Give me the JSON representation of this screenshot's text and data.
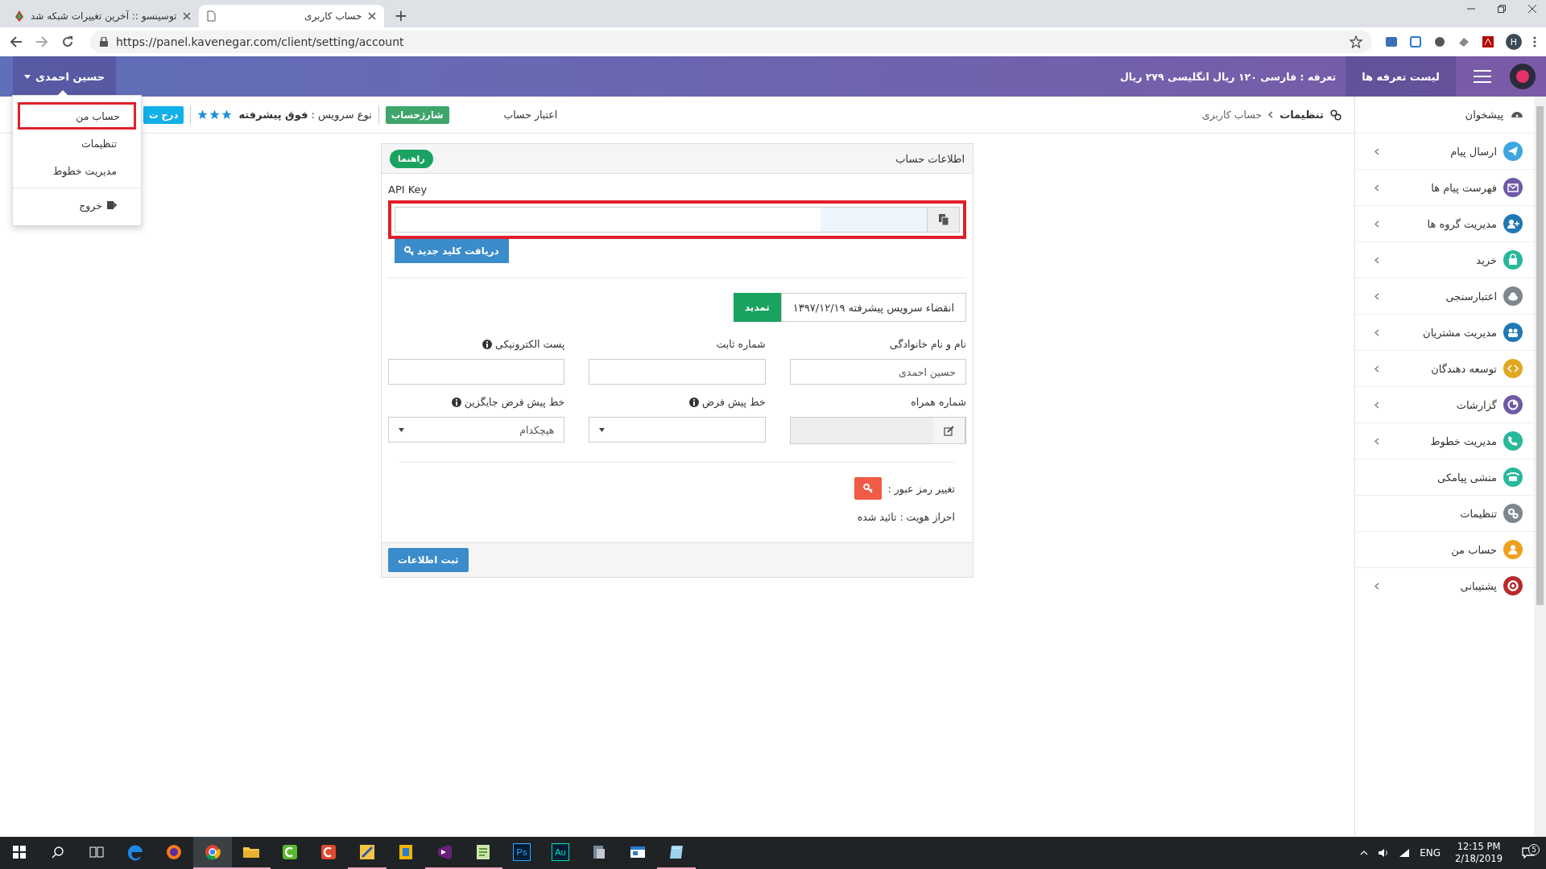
{
  "browser": {
    "tabs": [
      {
        "title": "حساب کاربری",
        "selected": true
      },
      {
        "title": "توسینسو :: آخرین تغییرات شبکه شد",
        "selected": false
      }
    ],
    "new_tab": "+",
    "url": "https://panel.kavenegar.com/client/setting/account",
    "profile": "H"
  },
  "header": {
    "tariff_button": "لیست تعرفه ها",
    "tariff": "تعرفه : فارسی ۱۲۰ ریال انگلیسی ۲۷۹ ریال",
    "user": "حسین احمدی",
    "user_menu_open": true
  },
  "user_menu": [
    {
      "label": "حساب من",
      "kind": "link",
      "highlighted": true
    },
    {
      "label": "تنظیمات",
      "kind": "link",
      "highlighted": false
    },
    {
      "label": "مدیریت خطوط",
      "kind": "link",
      "highlighted": false
    },
    {
      "label": "خروج",
      "kind": "logout",
      "highlighted": false
    }
  ],
  "toolbar": {
    "breadcrumb": [
      {
        "label": "تنظیمات"
      },
      {
        "label": "حساب کاربری"
      }
    ],
    "credit_label": "اعتبار حساب",
    "charge_button": "شارژحساب",
    "service": "نوع سرویس : **فوق پیشرفته**",
    "stars": 3,
    "insert_button": "درج ت"
  },
  "sidebar": {
    "home": "پیشخوان",
    "items": [
      {
        "label": "ارسال پیام",
        "color": "#3ea6e0",
        "has_submenu": true
      },
      {
        "label": "فهرست پیام ها",
        "color": "#6f5aa8",
        "has_submenu": true
      },
      {
        "label": "مدیریت گروه ها",
        "color": "#1f78b4",
        "has_submenu": true
      },
      {
        "label": "خرید",
        "color": "#26b99a",
        "has_submenu": true
      },
      {
        "label": "اعتبارسنجی",
        "color": "#7d8790",
        "has_submenu": true
      },
      {
        "label": "مدیریت مشتریان",
        "color": "#1f78b4",
        "has_submenu": true
      },
      {
        "label": "توسعه دهندگان",
        "color": "#e0a822",
        "has_submenu": true
      },
      {
        "label": "گزارشات",
        "color": "#6f5aa8",
        "has_submenu": true
      },
      {
        "label": "مدیریت خطوط",
        "color": "#26b99a",
        "has_submenu": true
      },
      {
        "label": "منشی پیامکی",
        "color": "#26b99a",
        "has_submenu": false
      },
      {
        "label": "تنظیمات",
        "color": "#7d8790",
        "has_submenu": false
      },
      {
        "label": "حساب من",
        "color": "#f0a020",
        "has_submenu": false
      },
      {
        "label": "پشتیبانی",
        "color": "#b92b2b",
        "has_submenu": true
      }
    ]
  },
  "card": {
    "title": "اطلاعات حساب",
    "help_button": "راهنما",
    "api_key": {
      "label": "API Key",
      "highlighted": true
    },
    "new_key_button": "دریافت کلید جدید",
    "expiry": "انقضاء سرویس پیشرفته ۱۳۹۷/۱۲/۱۹",
    "renew_button": "تمدید",
    "fields": [
      {
        "label": "نام و نام خانوادگی",
        "kind": "text",
        "value": "حسین احمدی",
        "info": false
      },
      {
        "label": "شماره ثابت",
        "kind": "text",
        "info": false
      },
      {
        "label": "پست الکترونیکی",
        "kind": "text",
        "info": true
      },
      {
        "label": "شماره همراه",
        "kind": "editable",
        "info": false
      },
      {
        "label": "خط پیش فرض",
        "kind": "select",
        "info": true
      },
      {
        "label": "خط پیش فرض جایگزین",
        "kind": "select",
        "value": "هیچکدام",
        "info": true
      }
    ],
    "password_label": "تغییر رمز عبور :",
    "verification": "احراز هویت : تائید شده",
    "submit_button": "ثبت اطلاعات"
  },
  "taskbar": {
    "apps": [
      {
        "kind": "pad",
        "running": true,
        "active": false
      },
      {
        "kind": "window",
        "running": false,
        "active": false
      },
      {
        "kind": "server",
        "running": false,
        "active": false
      },
      {
        "kind": "badge",
        "label": "Au",
        "color": "#00e4bb",
        "running": false,
        "active": false
      },
      {
        "kind": "badge",
        "label": "Ps",
        "color": "#31a8ff",
        "running": false,
        "active": false
      },
      {
        "kind": "notepad",
        "running": true,
        "active": false
      },
      {
        "kind": "vs",
        "running": true,
        "active": false
      },
      {
        "kind": "box",
        "running": false,
        "active": false
      },
      {
        "kind": "tool",
        "running": true,
        "active": false
      },
      {
        "kind": "red",
        "running": false,
        "active": false
      },
      {
        "kind": "green",
        "running": false,
        "active": false
      },
      {
        "kind": "folder",
        "running": true,
        "active": false
      },
      {
        "kind": "chrome",
        "running": true,
        "active": true
      },
      {
        "kind": "firefox",
        "running": false,
        "active": false
      },
      {
        "kind": "edge",
        "running": false,
        "active": false
      }
    ],
    "language": "ENG",
    "time": "12:15 PM",
    "date": "2/18/2019",
    "notifications": "5"
  }
}
